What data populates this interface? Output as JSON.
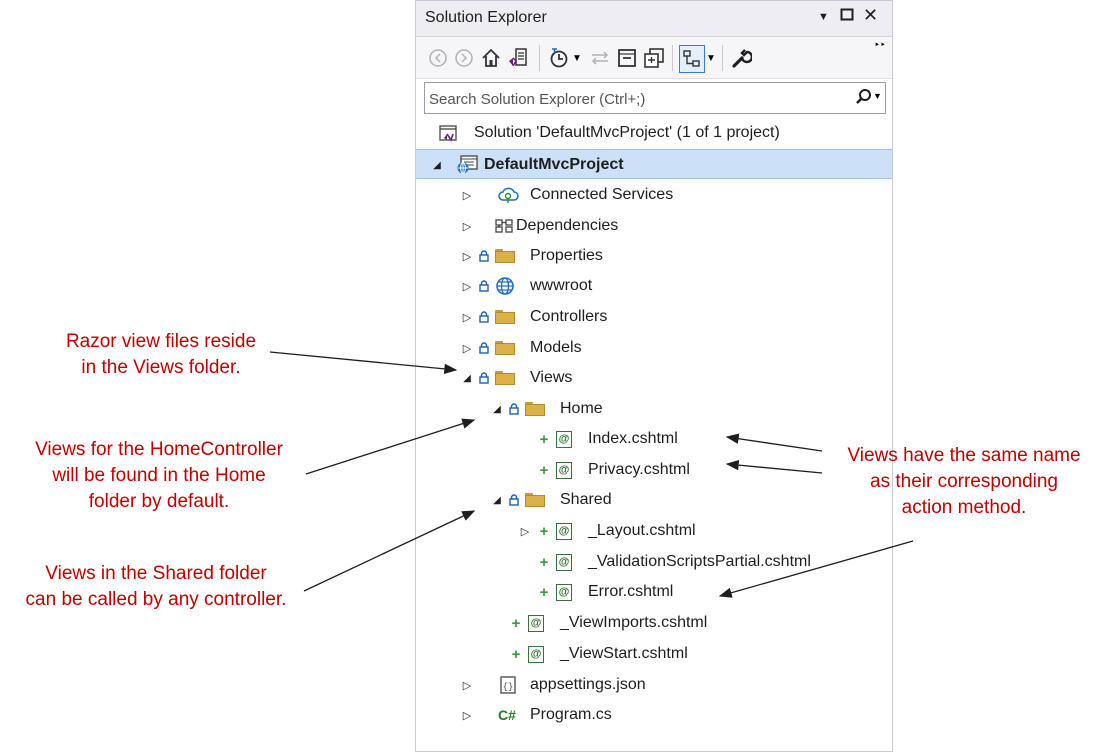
{
  "panel": {
    "title": "Solution Explorer",
    "search_placeholder": "Search Solution Explorer (Ctrl+;)"
  },
  "tree": {
    "solution": "Solution 'DefaultMvcProject' (1 of 1 project)",
    "project": "DefaultMvcProject",
    "items": {
      "connected_services": "Connected Services",
      "dependencies": "Dependencies",
      "properties": "Properties",
      "wwwroot": "wwwroot",
      "controllers": "Controllers",
      "models": "Models",
      "views": "Views",
      "home": "Home",
      "index": "Index.cshtml",
      "privacy": "Privacy.cshtml",
      "shared": "Shared",
      "layout": "_Layout.cshtml",
      "validation": "_ValidationScriptsPartial.cshtml",
      "error": "Error.cshtml",
      "viewimports": "_ViewImports.cshtml",
      "viewstart": "_ViewStart.cshtml",
      "appsettings": "appsettings.json",
      "program": "Program.cs"
    }
  },
  "annotations": {
    "razor_1": "Razor view files reside",
    "razor_2": "in the Views folder.",
    "home_1": "Views for the HomeController",
    "home_2": "will be found in the Home",
    "home_3": "folder by default.",
    "shared_1": "Views in the Shared folder",
    "shared_2": "can be called by any controller.",
    "same_1": "Views have the same name",
    "same_2": "as their corresponding",
    "same_3": "action method."
  },
  "colors": {
    "annotation": "#c00000",
    "selection": "#cce0f8",
    "folder": "#dcb049",
    "add_marker": "#3a9b3a"
  }
}
